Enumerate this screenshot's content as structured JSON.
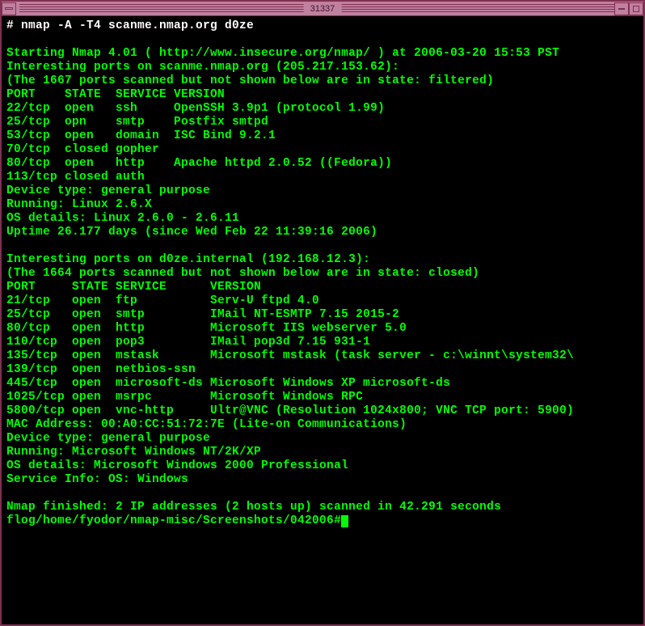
{
  "window": {
    "title": "31337"
  },
  "command": {
    "prompt": "# ",
    "line": "nmap -A -T4 scanme.nmap.org d0ze"
  },
  "output": {
    "start": "Starting Nmap 4.01 ( http://www.insecure.org/nmap/ ) at 2006-03-20 15:53 PST",
    "host1": {
      "header": "Interesting ports on scanme.nmap.org (205.217.153.62):",
      "filtered": "(The 1667 ports scanned but not shown below are in state: filtered)",
      "cols": "PORT    STATE  SERVICE VERSION",
      "p22": "22/tcp  open   ssh     OpenSSH 3.9p1 (protocol 1.99)",
      "p25": "25/tcp  opn    smtp    Postfix smtpd",
      "p53": "53/tcp  open   domain  ISC Bind 9.2.1",
      "p70": "70/tcp  closed gopher",
      "p80": "80/tcp  open   http    Apache httpd 2.0.52 ((Fedora))",
      "p113": "113/tcp closed auth",
      "devtype": "Device type: general purpose",
      "running": "Running: Linux 2.6.X",
      "osdet": "OS details: Linux 2.6.0 - 2.6.11",
      "uptime": "Uptime 26.177 days (since Wed Feb 22 11:39:16 2006)"
    },
    "host2": {
      "header": "Interesting ports on d0ze.internal (192.168.12.3):",
      "filtered": "(The 1664 ports scanned but not shown below are in state: closed)",
      "cols": "PORT     STATE SERVICE      VERSION",
      "p21": "21/tcp   open  ftp          Serv-U ftpd 4.0",
      "p25": "25/tcp   open  smtp         IMail NT-ESMTP 7.15 2015-2",
      "p80": "80/tcp   open  http         Microsoft IIS webserver 5.0",
      "p110": "110/tcp  open  pop3         IMail pop3d 7.15 931-1",
      "p135": "135/tcp  open  mstask       Microsoft mstask (task server - c:\\winnt\\system32\\",
      "p139": "139/tcp  open  netbios-ssn",
      "p445": "445/tcp  open  microsoft-ds Microsoft Windows XP microsoft-ds",
      "p1025": "1025/tcp open  msrpc        Microsoft Windows RPC",
      "p5800": "5800/tcp open  vnc-http     Ultr@VNC (Resolution 1024x800; VNC TCP port: 5900)",
      "mac": "MAC Address: 00:A0:CC:51:72:7E (Lite-on Communications)",
      "devtype": "Device type: general purpose",
      "running": "Running: Microsoft Windows NT/2K/XP",
      "osdet": "OS details: Microsoft Windows 2000 Professional",
      "svcinfo": "Service Info: OS: Windows"
    },
    "finish": "Nmap finished: 2 IP addresses (2 hosts up) scanned in 42.291 seconds",
    "prompt2": "flog/home/fyodor/nmap-misc/Screenshots/042006#"
  }
}
